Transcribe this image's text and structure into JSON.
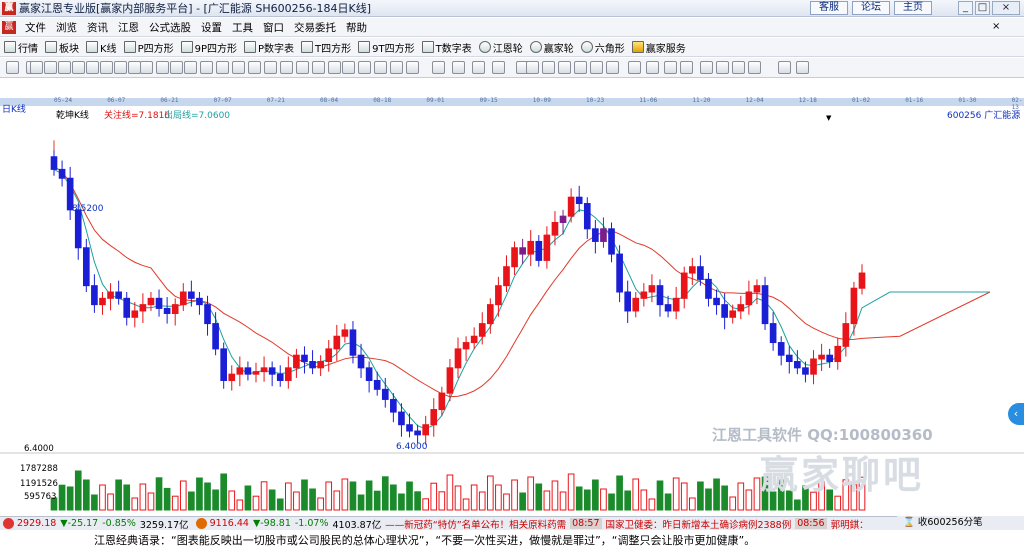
{
  "window": {
    "title": "赢家江恩专业版[赢家内部服务平台] - [广汇能源  SH600256-184日K线]",
    "links": [
      "客服",
      "论坛",
      "主页"
    ],
    "controls": [
      "_",
      "□",
      "×"
    ]
  },
  "menu": [
    "文件",
    "浏览",
    "资讯",
    "江恩",
    "公式选股",
    "设置",
    "工具",
    "窗口",
    "交易委托",
    "帮助"
  ],
  "toolbar1": [
    "行情",
    "板块",
    "K线",
    "P四方形",
    "9P四方形",
    "P数字表",
    "T四方形",
    "9T四方形",
    "T数字表",
    "江恩轮",
    "赢家轮",
    "六角形",
    "赢家服务"
  ],
  "date_axis": [
    "05-24",
    "06-07",
    "06-21",
    "07-07",
    "07-21",
    "08-04",
    "08-18",
    "09-01",
    "09-15",
    "10-09",
    "10-23",
    "11-06",
    "11-20",
    "12-04",
    "12-18",
    "01-02",
    "01-16",
    "01-30",
    "02-13"
  ],
  "chart": {
    "period_label": "日K线",
    "indicator_name": "乾坤K线",
    "attention_line": "关注线=7.1816",
    "exit_line": "出局线=7.0600",
    "stock": "600256  广汇能源",
    "dropdown_marker": "▼",
    "high_label": "8.5200",
    "low_label": "6.4000",
    "vol_axis": [
      "6.4000",
      "1787288",
      "1191526",
      "595763"
    ],
    "watermark_small": "江恩工具软件  QQ:100800360",
    "watermark_big": "赢家聊吧",
    "colors": {
      "up": "#e8141a",
      "down": "#1a1fd6",
      "purple": "#7a1e8c",
      "red_line": "#e03a2a",
      "teal_line": "#20a0a0"
    }
  },
  "chart_data": {
    "type": "candlestick",
    "symbol": "600256",
    "name": "广汇能源",
    "period": "日K线",
    "price_labels": {
      "high": 8.52,
      "low": 6.4
    },
    "volume_axis_ticks": [
      1787288,
      1191526,
      595763
    ],
    "indicator": {
      "attention_line": 7.1816,
      "exit_line": 7.06
    },
    "date_ticks": [
      "05-24",
      "06-07",
      "06-21",
      "07-07",
      "07-21",
      "08-04",
      "08-18",
      "09-01",
      "09-15",
      "10-09",
      "10-23",
      "11-06",
      "11-20",
      "12-04",
      "12-18",
      "01-02",
      "01-16",
      "01-30",
      "02-13"
    ],
    "price_range": [
      6.3,
      8.8
    ],
    "closes": [
      8.52,
      8.45,
      8.2,
      7.9,
      7.6,
      7.45,
      7.5,
      7.55,
      7.5,
      7.35,
      7.4,
      7.45,
      7.5,
      7.42,
      7.38,
      7.45,
      7.55,
      7.5,
      7.45,
      7.3,
      7.1,
      6.85,
      6.9,
      6.95,
      6.9,
      6.92,
      6.95,
      6.9,
      6.85,
      6.95,
      7.05,
      7.0,
      6.95,
      7.0,
      7.1,
      7.2,
      7.25,
      7.05,
      6.95,
      6.85,
      6.78,
      6.7,
      6.6,
      6.5,
      6.45,
      6.42,
      6.5,
      6.62,
      6.75,
      6.95,
      7.1,
      7.15,
      7.2,
      7.3,
      7.45,
      7.6,
      7.75,
      7.9,
      7.85,
      7.95,
      7.8,
      8.0,
      8.1,
      8.15,
      8.3,
      8.25,
      8.05,
      7.95,
      8.05,
      7.85,
      7.55,
      7.4,
      7.5,
      7.55,
      7.6,
      7.45,
      7.4,
      7.5,
      7.7,
      7.75,
      7.65,
      7.5,
      7.45,
      7.35,
      7.4,
      7.45,
      7.55,
      7.6,
      7.3,
      7.15,
      7.05,
      7.0,
      6.95,
      6.9,
      7.02,
      7.05,
      7.0,
      7.12,
      7.3,
      7.58,
      7.7
    ]
  },
  "status": {
    "sh_index": "2929.18",
    "sh_change": "▼-25.17",
    "sh_pct": "-0.85%",
    "sh_amount": "3259.17亿",
    "sz_index": "9116.44",
    "sz_change": "▼-98.81",
    "sz_pct": "-1.07%",
    "sz_amount": "4103.87亿",
    "ticker1": "——新冠药“特仿”名单公布！相关原料药需",
    "time1": "08:57",
    "ticker2": "国家卫健委：昨日新增本土确诊病例2388例",
    "time2": "08:56",
    "ticker3": "郭明錤：",
    "right_text": "收600256分笔"
  },
  "quote": "江恩经典语录：“图表能反映出一切股市或公司股民的总体心理状况”，“不要一次性买进，做慢就是罪过”，“调整只会让股市更加健康”。"
}
